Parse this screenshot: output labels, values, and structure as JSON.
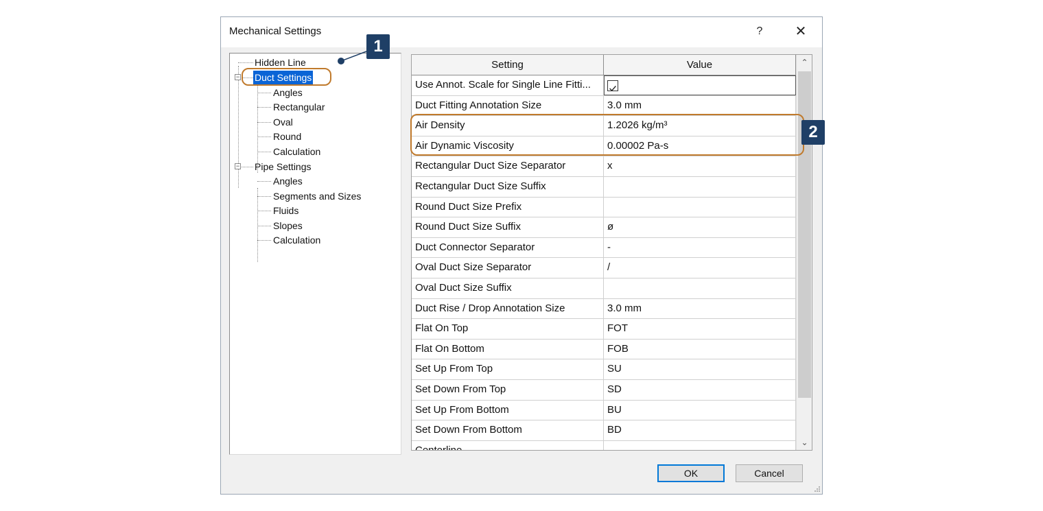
{
  "dialog": {
    "title": "Mechanical Settings",
    "help_label": "?",
    "close_label": "✕"
  },
  "tree": [
    {
      "label": "Hidden Line"
    },
    {
      "label": "Duct Settings",
      "selected": true
    },
    {
      "label": "Angles"
    },
    {
      "label": "Rectangular"
    },
    {
      "label": "Oval"
    },
    {
      "label": "Round"
    },
    {
      "label": "Calculation"
    },
    {
      "label": "Pipe Settings"
    },
    {
      "label": "Angles"
    },
    {
      "label": "Segments and Sizes"
    },
    {
      "label": "Fluids"
    },
    {
      "label": "Slopes"
    },
    {
      "label": "Calculation"
    }
  ],
  "grid": {
    "headers": {
      "setting": "Setting",
      "value": "Value"
    },
    "rows": [
      {
        "setting": "Use Annot. Scale for Single Line Fitti...",
        "value": "",
        "checkbox": true,
        "checked": true
      },
      {
        "setting": "Duct Fitting Annotation Size",
        "value": "3.0 mm"
      },
      {
        "setting": "Air Density",
        "value": "1.2026 kg/m³"
      },
      {
        "setting": "Air Dynamic Viscosity",
        "value": "0.00002 Pa-s"
      },
      {
        "setting": "Rectangular Duct Size Separator",
        "value": "x"
      },
      {
        "setting": "Rectangular Duct Size Suffix",
        "value": ""
      },
      {
        "setting": "Round Duct Size Prefix",
        "value": ""
      },
      {
        "setting": "Round Duct Size Suffix",
        "value": "ø"
      },
      {
        "setting": "Duct Connector Separator",
        "value": "-"
      },
      {
        "setting": "Oval Duct Size Separator",
        "value": "/"
      },
      {
        "setting": "Oval Duct Size Suffix",
        "value": ""
      },
      {
        "setting": "Duct Rise / Drop Annotation Size",
        "value": "3.0 mm"
      },
      {
        "setting": "Flat On Top",
        "value": "FOT"
      },
      {
        "setting": "Flat On Bottom",
        "value": "FOB"
      },
      {
        "setting": "Set Up From Top",
        "value": "SU"
      },
      {
        "setting": "Set Down From Top",
        "value": "SD"
      },
      {
        "setting": "Set Up From Bottom",
        "value": "BU"
      },
      {
        "setting": "Set Down From Bottom",
        "value": "BD"
      },
      {
        "setting": "Centerline",
        "value": ""
      }
    ]
  },
  "buttons": {
    "ok": "OK",
    "cancel": "Cancel"
  },
  "callouts": {
    "one": "1",
    "two": "2"
  },
  "colors": {
    "selection": "#0a64d6",
    "callout_badge": "#1f3f66",
    "callout_ring": "#c07a2c"
  }
}
